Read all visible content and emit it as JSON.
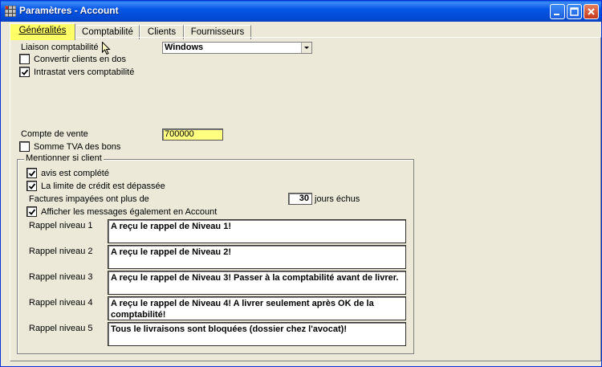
{
  "window": {
    "title": "Paramètres - Account"
  },
  "tabs": [
    {
      "label": "Généralités",
      "active": true
    },
    {
      "label": "Comptabilité",
      "active": false
    },
    {
      "label": "Clients",
      "active": false
    },
    {
      "label": "Fournisseurs",
      "active": false
    }
  ],
  "general": {
    "liaison_label": "Liaison comptabilité",
    "liaison_value": "Windows",
    "convert_clients_label": "Convertir clients en dos",
    "convert_clients_checked": false,
    "intrastat_label": "Intrastat vers comptabilité",
    "intrastat_checked": true,
    "compte_vente_label": "Compte de vente",
    "compte_vente_value": "700000",
    "somme_tva_label": "Somme TVA des bons",
    "somme_tva_checked": false
  },
  "mention": {
    "group_title": "Mentionner si client",
    "avis_label": "avis est complété",
    "avis_checked": true,
    "limite_label": "La limite de crédit est dépassée",
    "limite_checked": true,
    "factures_label": "Factures impayées ont plus de",
    "jours_value": "30",
    "jours_unit": "jours échus",
    "afficher_label": "Afficher les messages également en Account",
    "afficher_checked": true,
    "rappels": [
      {
        "label": "Rappel niveau 1",
        "text": "A reçu le rappel de Niveau 1!"
      },
      {
        "label": "Rappel niveau 2",
        "text": "A reçu le rappel de Niveau 2!"
      },
      {
        "label": "Rappel niveau 3",
        "text": "A reçu le rappel de Niveau 3! Passer à la comptabilité avant de livrer."
      },
      {
        "label": "Rappel niveau 4",
        "text": "A reçu le rappel de Niveau 4! A livrer seulement après OK de la comptabilité!"
      },
      {
        "label": "Rappel niveau 5",
        "text": "Tous le livraisons sont bloquées (dossier chez l'avocat)!"
      }
    ]
  },
  "icons": {
    "app": "grid-app-icon",
    "minimize": "minimize-icon",
    "maximize": "maximize-icon",
    "close": "close-icon",
    "checkmark": "checkmark-icon",
    "dropdown": "chevron-down-icon",
    "cursor": "mouse-pointer-icon"
  },
  "colors": {
    "titlebar": "#0454e4",
    "active_tab": "#ffff66",
    "highlight_field": "#ffff80",
    "window_bg": "#ece9d8"
  }
}
